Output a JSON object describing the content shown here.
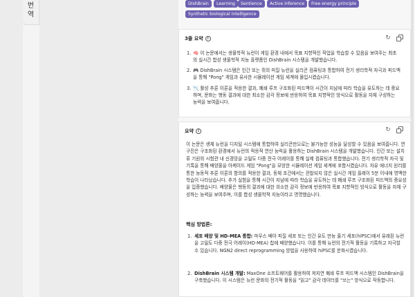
{
  "side_tab": {
    "char1": "번",
    "char2": "역"
  },
  "tags": [
    "DishBrain",
    "Learning",
    "Sentience",
    "Active inference",
    "Free energy principle",
    "Synthetic biological intelligence"
  ],
  "summary_card": {
    "title": "3줄 요약",
    "items": [
      {
        "num": "1.",
        "emoji": "🧠",
        "text": "이 논문에서는 생물학적 뉴런이 게임 환경 내에서 목표 지향적인 작업을 학습할 수 있음을 보여주는 최초의 실시간 합성 생물학적 지능 플랫폼인 DishBrain 시스템을 개발했습니다."
      },
      {
        "num": "2.",
        "emoji": "🎮",
        "text": "DishBrain 시스템은 인간 또는 쥐의 피질 뉴런을 실리콘 컴퓨팅과 통합하여 전기 생리학적 자극과 피드백을 통해 \"Pong\" 게임과 유사한 시뮬레이션 게임 세계에 몰입시켰습니다."
      },
      {
        "num": "3.",
        "emoji": "📉",
        "text": "활성 추론 이론을 적용한 결과, 폐쇄 루프 구조화된 피드백이 시간이 지남에 따라 학습을 유도하는 데 중요하며, 문화는 행동 결과에 대한 최소한 감각 정보에 반응하여 목표 지향적인 방식으로 활동을 자체 구성하는 능력을 보여줍니다."
      }
    ]
  },
  "abstract_card": {
    "title": "요약",
    "paragraph": "이 논문은 생체 뉴런을 디지털 시스템에 통합하여 실리콘만으로는 불가능한 성능을 달성할 수 있음을 보여줍니다. 연구진은 구조화된 환경에서 뉴런의 적응적 연산 능력을 활용하는 DishBrain 시스템을 개발했습니다. 인간 또는 설치류 기원의 시험관 내 신경망을 고밀도 다중 전극 어레이를 통해 실제 컴퓨팅과 통합했습니다. 전기 생리학적 자극 및 기록을 통해 배양물을 아케이드 게임 \"Pong\"을 모방한 시뮬레이션 게임 세계에 포함시켰습니다. 자유 에너지 원리를 통한 능동적 추론 이론의 함의를 적용한 결과, 동체 조건에서는 관찰되지 않은 실시간 게임 플레이 5분 이내에 명백한 학습이 나타났습니다. 추가 실험을 통해 시간이 지남에 따라 학습을 유도하는 데 폐쇄 루프 구조화된 피드백의 중요성을 입증했습니다. 배양물은 행동의 결과에 대한 희소한 감각 정보에 반응하여 목표 지향적인 방식으로 활동을 자체 구성하는 능력을 보여주며, 이를 합성 생물학적 지능이라고 명명했습니다.",
    "methods_title": "핵심 방법론:",
    "methods": [
      {
        "num": "1.",
        "label": "세포 배양 및 HD-MEA 통합:",
        "text": " 마우스 배아 피질 세포 또는 인간 유도 만능 줄기 세포(hiPSC)에서 유래된 뉴런을 고밀도 다중 전극 어레이(HD-MEA) 칩에 배양했습니다. 이를 통해 뉴런의 전기적 활동을 기록하고 자극할 수 있습니다. NGN2 direct reprogramming 방법을 사용하여 hiPSC를 분화시켰습니다."
      },
      {
        "num": "2.",
        "label": "DishBrain 시스템 개발:",
        "text": " MaxOne 소프트웨어를 활용하여 저지연 폐쇄 루프 피드백 시스템인 DishBrain을 구축했습니다. 이 시스템은 뉴런 문화의 전기적 활동을 \"읽고\" 감각 데이터를 \"쓰는\" 방식으로 작동합니다."
      }
    ]
  }
}
